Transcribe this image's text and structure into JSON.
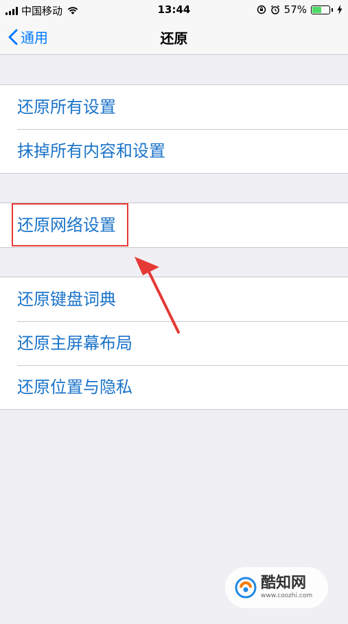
{
  "status_bar": {
    "carrier": "中国移动",
    "time": "13:44",
    "battery_percent": "57%",
    "battery_level": 0.57
  },
  "nav": {
    "back_label": "通用",
    "title": "还原"
  },
  "groups": [
    {
      "items": [
        "还原所有设置",
        "抹掉所有内容和设置"
      ]
    },
    {
      "items": [
        "还原网络设置"
      ]
    },
    {
      "items": [
        "还原键盘词典",
        "还原主屏幕布局",
        "还原位置与隐私"
      ]
    }
  ],
  "annotation": {
    "highlighted_item": "还原网络设置",
    "color": "#e53935"
  },
  "watermark": {
    "name": "酷知网",
    "url": "www.coozhi.com"
  },
  "colors": {
    "accent": "#007aff",
    "row_text": "#1a73c8",
    "background": "#efeff4",
    "battery": "#4cd964"
  }
}
